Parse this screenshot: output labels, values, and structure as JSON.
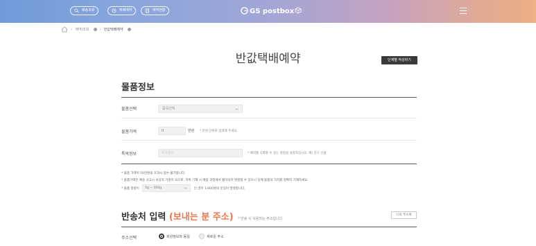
{
  "header": {
    "pills": [
      {
        "icon": "search-icon",
        "label": "배송조회"
      },
      {
        "icon": "clock-icon",
        "label": "택배예약"
      },
      {
        "icon": "receipt-icon",
        "label": "예약현황"
      }
    ],
    "logo": "GS postbox",
    "menu_icon": "hamburger-icon"
  },
  "breadcrumb": {
    "home_icon": "home-icon",
    "items": [
      "예약/조회",
      "반값택배예약"
    ]
  },
  "page": {
    "title": "반값택배예약",
    "step_button": "단계별 작성하기"
  },
  "product": {
    "section_title": "물품정보",
    "category_label": "물품선택",
    "category_value": "품목선택",
    "price_label": "물품가액",
    "price_value": "0",
    "price_unit": "만원",
    "price_hint": "* 만원 단위로 입력해 주세요.",
    "info_label": "특목정보",
    "info_placeholder": "특목정보",
    "info_hint": "* 예약품 식별할 수 있는 명칭을 설정하십시오. 예) 친구 선물",
    "notes": [
      "* 물품 가액이 50만원을 초과시 접수 불가합니다.",
      "* 물품가액은 배송 사고시 보상의 기준이 되므로, 허위 기재 시 배송 과정에서 불이익이 발생할 수 있으니 실제 물품의 가치를 정확히 기재하세요.",
      "* 물품 중량이",
      "인 경우  1,600원의 운임이 발생합니다."
    ],
    "weight_value": "0g ~ 500g"
  },
  "sender": {
    "section_title": "반송처 입력",
    "section_accent": "(보내는 분 주소)",
    "section_note": "* 반송 시 사용되는 주소입니다.",
    "my_address_button": "나의 주소록",
    "address_label": "주소선택",
    "options": [
      "회원정보와 동일",
      "새로운 주소"
    ]
  },
  "colors": {
    "accent": "#f0764a",
    "gradient_start": "#6f9bd8",
    "gradient_end": "#ecb082"
  }
}
